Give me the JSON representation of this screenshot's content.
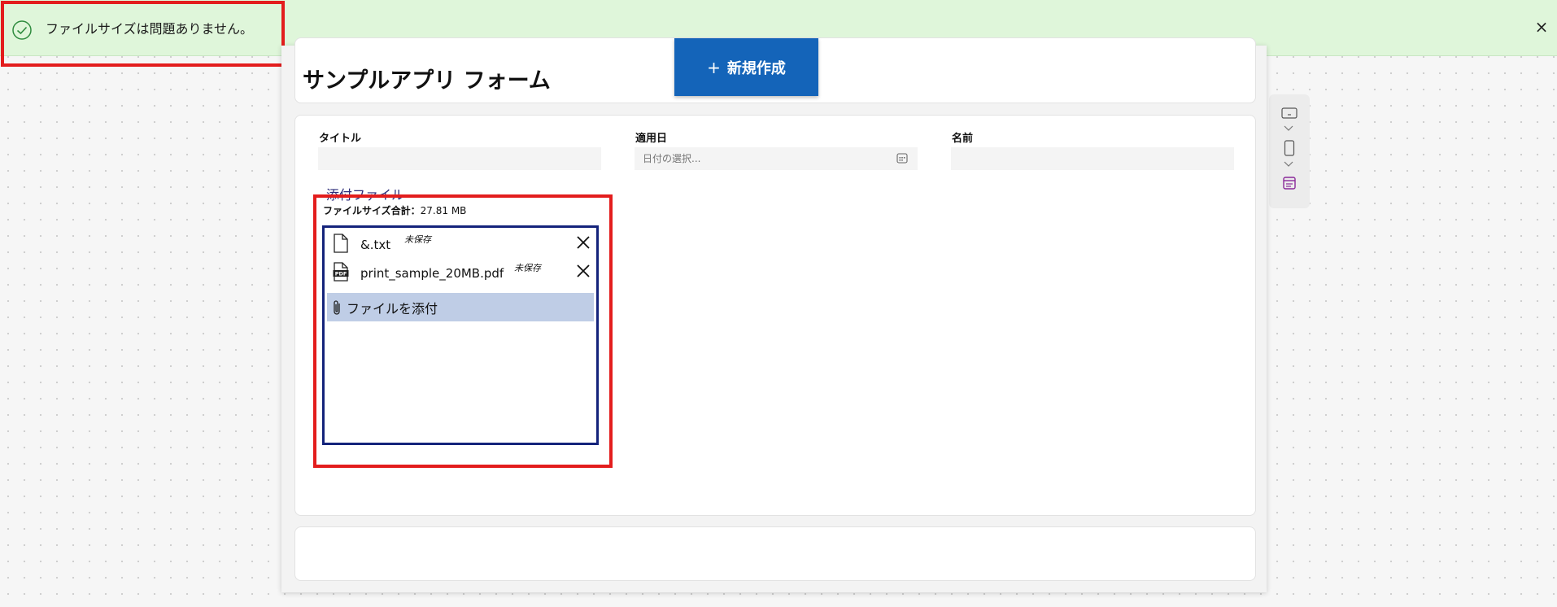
{
  "notification": {
    "message": "ファイルサイズは問題ありません。",
    "close_symbol": "×",
    "status_icon": "check-circle-icon",
    "color": "#dff6da"
  },
  "header": {
    "title": "サンプルアプリ フォーム",
    "new_button_label": "新規作成",
    "new_button_symbol": "+",
    "accent": "#1464b9"
  },
  "form": {
    "fields": [
      {
        "label": "タイトル",
        "value": "",
        "placeholder": ""
      },
      {
        "label": "適用日",
        "value": "",
        "placeholder": "日付の選択..."
      },
      {
        "label": "名前",
        "value": "",
        "placeholder": ""
      }
    ],
    "attachments": {
      "label": "添付ファイル",
      "size_total_label": "ファイルサイズ合計：",
      "size_total_value": "27.81 MB",
      "files": [
        {
          "name": "&.txt",
          "status": "未保存",
          "icon": "file-icon"
        },
        {
          "name": "print_sample_20MB.pdf",
          "status": "未保存",
          "icon": "pdf-icon"
        }
      ],
      "attach_button_label": "ファイルを添付"
    }
  },
  "rail": {
    "icons": [
      "monitor-icon",
      "chevron-down-icon",
      "phone-icon",
      "chevron-down-icon",
      "form-icon"
    ]
  }
}
